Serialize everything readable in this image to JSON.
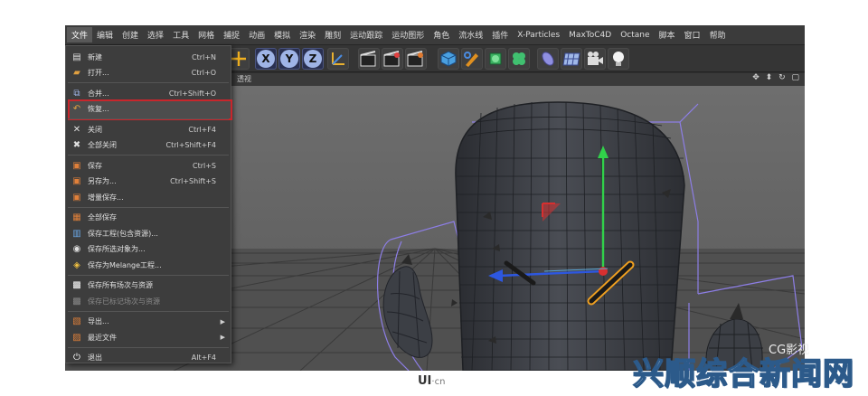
{
  "menubar": {
    "items": [
      "文件",
      "编辑",
      "创建",
      "选择",
      "工具",
      "网格",
      "捕捉",
      "动画",
      "模拟",
      "渲染",
      "雕刻",
      "运动跟踪",
      "运动图形",
      "角色",
      "流水线",
      "插件",
      "X-Particles",
      "MaxToC4D",
      "Octane",
      "脚本",
      "窗口",
      "帮助"
    ]
  },
  "toolbar": {
    "axis_buttons": [
      "X",
      "Y",
      "Z"
    ]
  },
  "viewport": {
    "title": "透视",
    "nav_icons": [
      "move-icon",
      "zoom-icon",
      "rotate-icon",
      "maximize-icon"
    ]
  },
  "file_menu": {
    "items": [
      {
        "label": "新建",
        "shortcut": "Ctrl+N",
        "icon": "new-file-icon"
      },
      {
        "label": "打开...",
        "shortcut": "Ctrl+O",
        "icon": "open-folder-icon"
      },
      {
        "label": "合并...",
        "shortcut": "Ctrl+Shift+O",
        "icon": "merge-icon",
        "highlighted": true
      },
      {
        "label": "恢复...",
        "shortcut": "",
        "icon": "revert-icon"
      },
      {
        "label": "关闭",
        "shortcut": "Ctrl+F4",
        "icon": "close-doc-icon"
      },
      {
        "label": "全部关闭",
        "shortcut": "Ctrl+Shift+F4",
        "icon": "close-all-icon"
      },
      {
        "label": "保存",
        "shortcut": "Ctrl+S",
        "icon": "save-icon"
      },
      {
        "label": "另存为...",
        "shortcut": "Ctrl+Shift+S",
        "icon": "save-as-icon"
      },
      {
        "label": "增量保存...",
        "shortcut": "",
        "icon": "save-incremental-icon"
      },
      {
        "label": "全部保存",
        "shortcut": "",
        "icon": "save-all-icon"
      },
      {
        "label": "保存工程(包含资源)...",
        "shortcut": "",
        "icon": "save-project-icon"
      },
      {
        "label": "保存所选对象为...",
        "shortcut": "",
        "icon": "save-selected-icon"
      },
      {
        "label": "保存为Melange工程...",
        "shortcut": "",
        "icon": "save-melange-icon"
      },
      {
        "label": "保存所有场次与资源",
        "shortcut": "",
        "icon": "save-takes-icon"
      },
      {
        "label": "保存已标记场次与资源",
        "shortcut": "",
        "icon": "save-marked-takes-icon",
        "disabled": true
      },
      {
        "label": "导出...",
        "shortcut": "",
        "icon": "export-icon",
        "submenu": true
      },
      {
        "label": "最近文件",
        "shortcut": "",
        "icon": "recent-files-icon",
        "submenu": true
      },
      {
        "label": "退出",
        "shortcut": "Alt+F4",
        "icon": "power-icon"
      }
    ]
  },
  "watermark": {
    "logo": "UI",
    "logo_suffix": "·cn",
    "cg_mark": "CG影视",
    "site_text": "兴顺综合新闻网"
  },
  "colors": {
    "menu_bg": "#3d3d3d",
    "highlight_border": "#c8262c",
    "viewport_bg": "#6b6b6b",
    "model_color": "#3c3f45",
    "wire_color": "#8d7ee6",
    "y_axis": "#31d14a",
    "x_axis": "#2d57e0",
    "selected_edge": "#f0a020"
  }
}
